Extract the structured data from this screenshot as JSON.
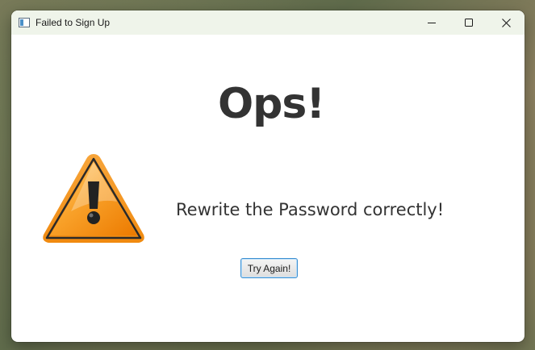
{
  "window": {
    "title": "Failed to Sign Up",
    "controls": {
      "minimize_icon": "minimize-icon",
      "maximize_icon": "maximize-icon",
      "close_icon": "close-icon"
    }
  },
  "dialog": {
    "headline": "Ops!",
    "message": "Rewrite the Password correctly!",
    "icon": "warning-icon",
    "button_label": "Try Again!"
  },
  "colors": {
    "titlebar_bg": "#eff4ea",
    "text": "#333333",
    "warning_orange": "#f28a00",
    "button_border": "#3c8fd0"
  }
}
